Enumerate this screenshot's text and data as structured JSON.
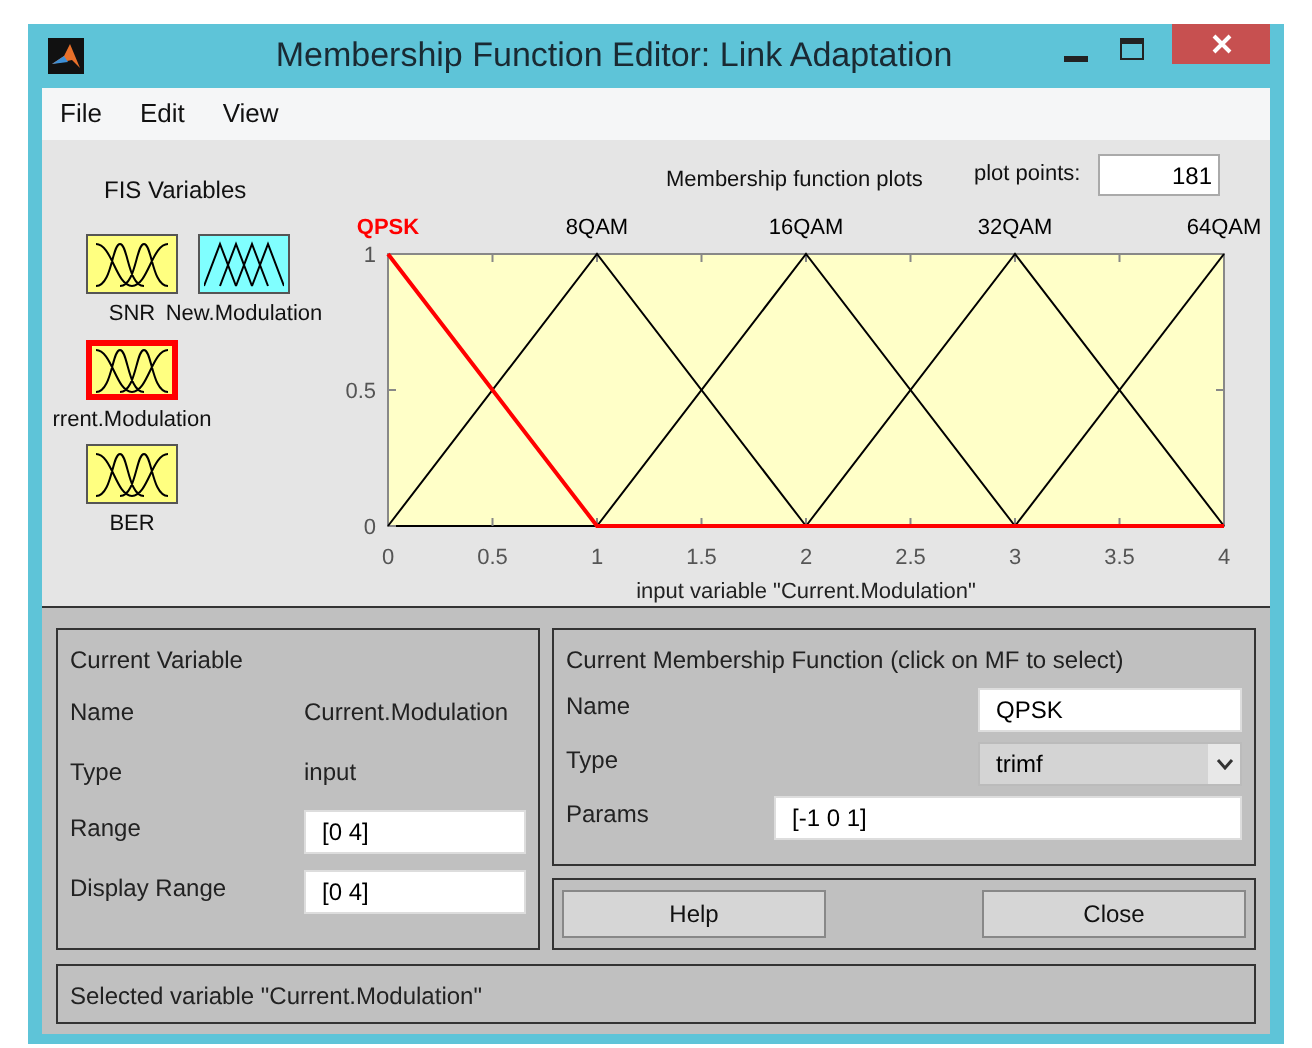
{
  "window": {
    "title": "Membership Function Editor: Link Adaptation"
  },
  "menu": [
    "File",
    "Edit",
    "View"
  ],
  "fis_variables": {
    "title": "FIS Variables",
    "items": [
      {
        "label": "SNR",
        "kind": "input",
        "selected": false
      },
      {
        "label": "rrent.Modulation",
        "kind": "input",
        "selected": true
      },
      {
        "label": "BER",
        "kind": "input",
        "selected": false
      },
      {
        "label": "New.Modulation",
        "kind": "output",
        "selected": false
      }
    ]
  },
  "plot_header": {
    "title": "Membership function plots",
    "plot_points_label": "plot points:",
    "plot_points": "181"
  },
  "chart_data": {
    "type": "line",
    "xlabel": "input variable \"Current.Modulation\"",
    "x": [
      0,
      1,
      2,
      3,
      4
    ],
    "xlim": [
      0,
      4
    ],
    "ylim": [
      0,
      1
    ],
    "xticks": [
      0,
      0.5,
      1,
      1.5,
      2,
      2.5,
      3,
      3.5,
      4
    ],
    "yticks": [
      0,
      0.5,
      1
    ],
    "series": [
      {
        "name": "QPSK",
        "color": "#ff0000",
        "values": [
          1,
          0,
          0,
          0,
          0
        ]
      },
      {
        "name": "8QAM",
        "color": "#000000",
        "values": [
          0,
          1,
          0,
          null,
          null
        ]
      },
      {
        "name": "16QAM",
        "color": "#000000",
        "values": [
          null,
          0,
          1,
          0,
          null
        ]
      },
      {
        "name": "32QAM",
        "color": "#000000",
        "values": [
          null,
          null,
          0,
          1,
          0
        ]
      },
      {
        "name": "64QAM",
        "color": "#000000",
        "values": [
          null,
          null,
          null,
          0,
          1
        ]
      }
    ]
  },
  "current_variable": {
    "title": "Current Variable",
    "name_label": "Name",
    "name": "Current.Modulation",
    "type_label": "Type",
    "type": "input",
    "range_label": "Range",
    "range": "[0 4]",
    "display_range_label": "Display Range",
    "display_range": "[0 4]"
  },
  "current_mf": {
    "title": "Current Membership Function (click on MF to select)",
    "name_label": "Name",
    "name": "QPSK",
    "type_label": "Type",
    "type": "trimf",
    "params_label": "Params",
    "params": "[-1 0 1]"
  },
  "buttons": [
    "Help",
    "Close"
  ],
  "status": "Selected variable \"Current.Modulation\""
}
